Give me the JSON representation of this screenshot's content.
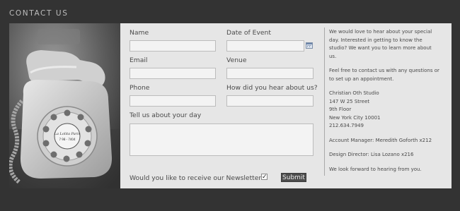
{
  "header": {
    "title": "CONTACT US"
  },
  "form": {
    "name_label": "Name",
    "date_label": "Date of Event",
    "email_label": "Email",
    "venue_label": "Venue",
    "phone_label": "Phone",
    "source_label": "How did you hear about us?",
    "about_label": "Tell us about your day",
    "name_value": "",
    "date_value": "",
    "email_value": "",
    "venue_value": "",
    "phone_value": "",
    "source_value": "",
    "about_value": "",
    "newsletter_label": "Would you like to receive our Newsletter?",
    "newsletter_checked": true,
    "newsletter_tick": "✓",
    "submit_label": "Submit"
  },
  "photo": {
    "dial_text": "La Lolita Paris",
    "dial_number": "7 98 - 7404"
  },
  "info": {
    "intro_line1": "We would love to hear about your special",
    "intro_line2": "day. Interested in getting to know the",
    "intro_line3": "studio? We want you to learn more about",
    "intro_line4": "us.",
    "contact_line1": "Feel free to contact us with any questions or",
    "contact_line2": "to set up an appointment.",
    "address_name": "Christian Oth Studio",
    "address_street": "147 W 25 Street",
    "address_floor": "9th Floor",
    "address_city": "New York City 10001",
    "address_phone": "212.634.7949",
    "account_manager": "Account Manager: Meredith Goforth x212",
    "design_director": "Design Director: Lisa Lozano x216",
    "closing": "We look forward to hearing from you."
  },
  "colors": {
    "background": "#333333",
    "panel": "#e6e6e6",
    "button": "#4d4d4d",
    "text": "#4a4a4a"
  },
  "icons": {
    "calendar": "calendar-icon",
    "checkbox": "checkmark-icon"
  }
}
